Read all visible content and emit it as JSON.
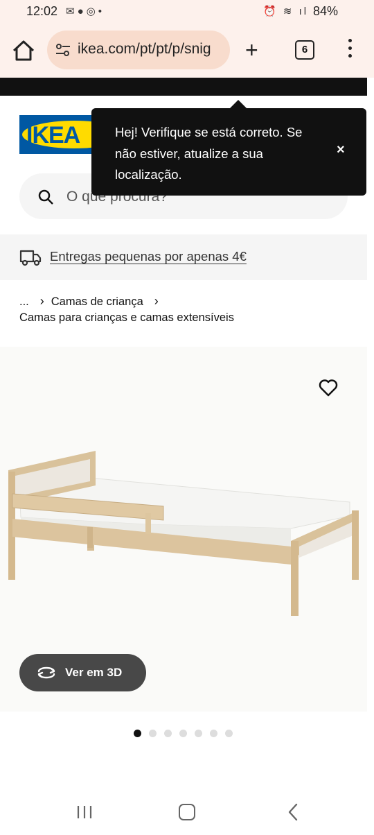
{
  "status_bar": {
    "time": "12:02",
    "battery": "84%"
  },
  "browser": {
    "url": "ikea.com/pt/pt/p/snig",
    "tab_count": "6"
  },
  "logo_text": "IKEA",
  "search": {
    "placeholder": "O que procura?"
  },
  "tooltip": {
    "text": "Hej! Verifique se está correto. Se não estiver, atualize a sua localização.",
    "close": "×"
  },
  "banner": {
    "text": "Entregas pequenas por apenas 4€"
  },
  "breadcrumb": {
    "ellipsis": "...",
    "level1": "Camas de criança",
    "level2": "Camas para crianças e camas extensíveis"
  },
  "product": {
    "view3d_label": "Ver em 3D",
    "image_count": 7,
    "active_image": 1
  },
  "colors": {
    "ikea_blue": "#0058a3",
    "ikea_yellow": "#ffdb00",
    "browser_bar": "#fdf1ec",
    "url_pill": "#f8dccd"
  }
}
